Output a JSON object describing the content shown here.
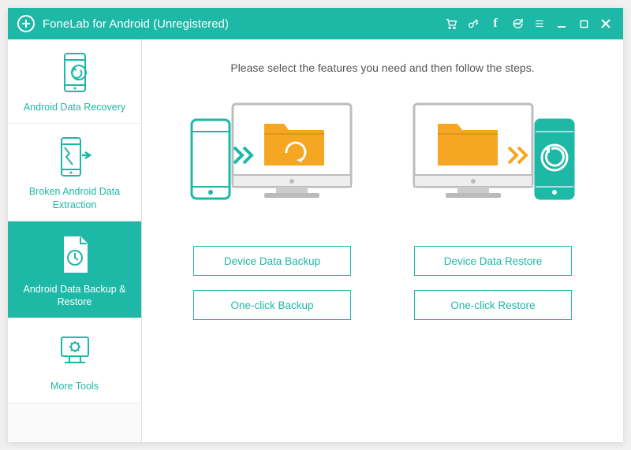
{
  "titlebar": {
    "app_title": "FoneLab for Android (Unregistered)"
  },
  "sidebar": {
    "items": [
      {
        "label": "Android Data Recovery"
      },
      {
        "label": "Broken Android Data Extraction"
      },
      {
        "label": "Android Data Backup & Restore"
      },
      {
        "label": "More Tools"
      }
    ],
    "active_index": 2
  },
  "main": {
    "instruction": "Please select the features you need and then follow the steps.",
    "buttons": {
      "device_backup": "Device Data Backup",
      "device_restore": "Device Data Restore",
      "one_click_backup": "One-click Backup",
      "one_click_restore": "One-click Restore"
    }
  },
  "colors": {
    "accent": "#1eb8a6",
    "folder": "#f5a623"
  }
}
